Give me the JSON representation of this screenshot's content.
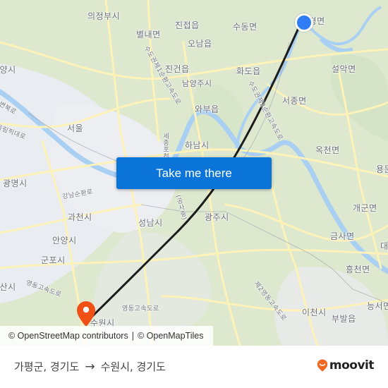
{
  "map": {
    "labels": [
      {
        "text": "의정부시",
        "kind": "place"
      },
      {
        "text": "진접읍",
        "kind": "place"
      },
      {
        "text": "수동면",
        "kind": "place"
      },
      {
        "text": "청평면",
        "kind": "place"
      },
      {
        "text": "별내면",
        "kind": "place"
      },
      {
        "text": "오남읍",
        "kind": "place"
      },
      {
        "text": "진건읍",
        "kind": "place"
      },
      {
        "text": "화도읍",
        "kind": "place"
      },
      {
        "text": "설악면",
        "kind": "place"
      },
      {
        "text": "남양주시",
        "kind": "place"
      },
      {
        "text": "와부읍",
        "kind": "place"
      },
      {
        "text": "서종면",
        "kind": "place"
      },
      {
        "text": "고양시",
        "kind": "place"
      },
      {
        "text": "서울",
        "kind": "place"
      },
      {
        "text": "하남시",
        "kind": "place"
      },
      {
        "text": "옥천면",
        "kind": "place"
      },
      {
        "text": "용문면",
        "kind": "place"
      },
      {
        "text": "광명시",
        "kind": "place"
      },
      {
        "text": "개군면",
        "kind": "place"
      },
      {
        "text": "과천시",
        "kind": "place"
      },
      {
        "text": "성남시",
        "kind": "place"
      },
      {
        "text": "광주시",
        "kind": "place"
      },
      {
        "text": "안양시",
        "kind": "place"
      },
      {
        "text": "금사면",
        "kind": "place"
      },
      {
        "text": "군포시",
        "kind": "place"
      },
      {
        "text": "대신면",
        "kind": "place"
      },
      {
        "text": "흥천면",
        "kind": "place"
      },
      {
        "text": "안산시",
        "kind": "place"
      },
      {
        "text": "이천시",
        "kind": "place"
      },
      {
        "text": "능서면",
        "kind": "place"
      },
      {
        "text": "부발읍",
        "kind": "place"
      },
      {
        "text": "수원시",
        "kind": "place"
      },
      {
        "text": "강남순환로",
        "kind": "road"
      },
      {
        "text": "영동고속도로",
        "kind": "road"
      },
      {
        "text": "영동고속도로",
        "kind": "road"
      },
      {
        "text": "올림픽대로",
        "kind": "road"
      },
      {
        "text": "강변북로",
        "kind": "road"
      },
      {
        "text": "세종포천고속도로",
        "kind": "road"
      },
      {
        "text": "(공사중)",
        "kind": "road"
      },
      {
        "text": "수도권제1순환고속도로",
        "kind": "road"
      },
      {
        "text": "수도권제2순환고속도로",
        "kind": "road"
      },
      {
        "text": "제2영동고속도로",
        "kind": "road"
      }
    ],
    "origin_marker": {
      "name": "가평군, 경기도",
      "color": "#2e7df5"
    },
    "destination_marker": {
      "name": "수원시, 경기도",
      "color": "#f04f15"
    },
    "route_line_color": "#1c1c1c",
    "colors": {
      "water": "#a9d0f3",
      "road": "#fdf2b8",
      "land": "#dfe9d2",
      "urban": "#eceef2"
    }
  },
  "cta": {
    "label": "Take me there",
    "color": "#0a74d8"
  },
  "attribution": {
    "osm": "© OpenStreetMap contributors",
    "separator": "|",
    "omt": "© OpenMapTiles"
  },
  "footer": {
    "origin": "가평군, 경기도",
    "arrow": "→",
    "destination": "수원시, 경기도",
    "logo_text": "moovit",
    "logo_color": "#f26722"
  }
}
